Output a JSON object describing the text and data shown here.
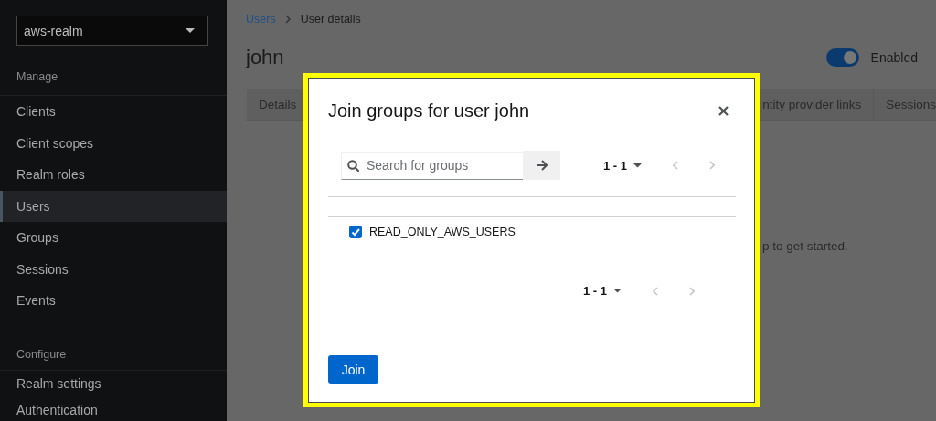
{
  "sidebar": {
    "realm_select": "aws-realm",
    "sections": [
      {
        "heading": "Manage",
        "items": [
          {
            "label": "Clients",
            "selected": false
          },
          {
            "label": "Client scopes",
            "selected": false
          },
          {
            "label": "Realm roles",
            "selected": false
          },
          {
            "label": "Users",
            "selected": true
          },
          {
            "label": "Groups",
            "selected": false
          },
          {
            "label": "Sessions",
            "selected": false
          },
          {
            "label": "Events",
            "selected": false
          }
        ]
      },
      {
        "heading": "Configure",
        "items": [
          {
            "label": "Realm settings",
            "selected": false
          },
          {
            "label": "Authentication",
            "selected": false
          }
        ]
      }
    ]
  },
  "breadcrumb": [
    {
      "label": "Users",
      "kind": "link"
    },
    {
      "label": "User details",
      "kind": "current"
    }
  ],
  "page": {
    "title": "john",
    "enabled_toggle": {
      "label": "Enabled",
      "on": true
    }
  },
  "tabs": [
    {
      "label": "Details"
    },
    {
      "label": "ntity provider links"
    },
    {
      "label": "Sessions"
    }
  ],
  "empty_state": {
    "text": "p to get started."
  },
  "modal": {
    "title": "Join groups for user john",
    "search": {
      "placeholder": "Search for groups"
    },
    "pagination_top": {
      "range": "1 - 1"
    },
    "groups": [
      {
        "name": "READ_ONLY_AWS_USERS",
        "checked": true
      }
    ],
    "pagination_bottom": {
      "range": "1 - 1"
    },
    "join_button": "Join"
  }
}
